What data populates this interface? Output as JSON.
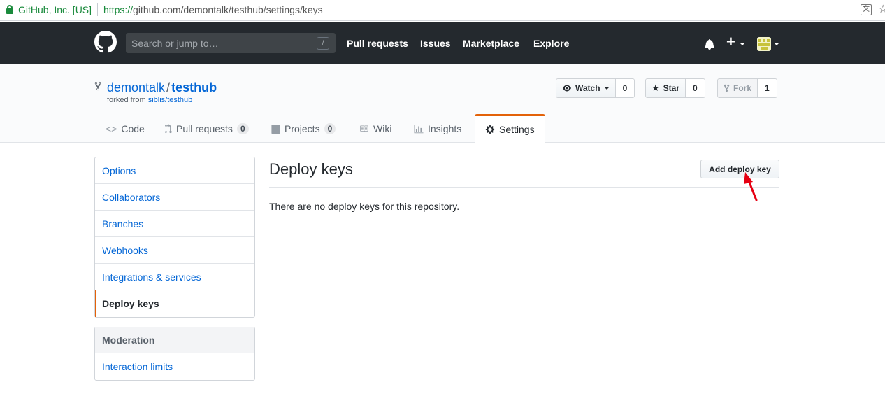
{
  "browser": {
    "origin": "GitHub, Inc. [US]",
    "url_scheme": "https://",
    "url_rest": "github.com/demontalk/testhub/settings/keys"
  },
  "header": {
    "search_placeholder": "Search or jump to…",
    "search_shortcut": "/",
    "nav": [
      "Pull requests",
      "Issues",
      "Marketplace",
      "Explore"
    ],
    "plus_symbol": "+"
  },
  "repo": {
    "owner": "demontalk",
    "separator": "/",
    "name": "testhub",
    "forked_prefix": "forked from ",
    "forked_from": "siblis/testhub",
    "watch_label": "Watch",
    "watch_count": "0",
    "star_label": "Star",
    "star_count": "0",
    "fork_label": "Fork",
    "fork_count": "1"
  },
  "tabs": {
    "code": "Code",
    "pull_requests": "Pull requests",
    "pull_requests_count": "0",
    "projects": "Projects",
    "projects_count": "0",
    "wiki": "Wiki",
    "insights": "Insights",
    "settings": "Settings"
  },
  "sidebar": {
    "items": [
      "Options",
      "Collaborators",
      "Branches",
      "Webhooks",
      "Integrations & services",
      "Deploy keys"
    ],
    "moderation_heading": "Moderation",
    "moderation_items": [
      "Interaction limits"
    ]
  },
  "main": {
    "title": "Deploy keys",
    "add_button": "Add deploy key",
    "blankslate": "There are no deploy keys for this repository."
  },
  "colors": {
    "header_bg": "#24292e",
    "link": "#0366d6",
    "selected_accent": "#e36209",
    "annotation_arrow": "#e60012"
  }
}
